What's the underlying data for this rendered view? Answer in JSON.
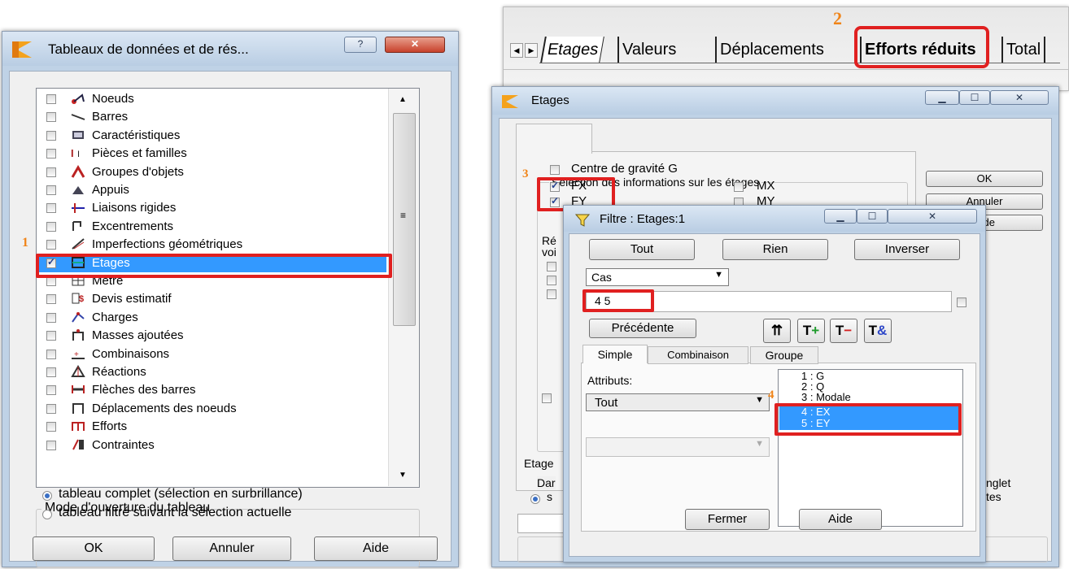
{
  "win1": {
    "title": "Tableaux de données et de rés...",
    "help_btn": "?",
    "close_btn": "✕",
    "items": [
      {
        "label": "Noeuds",
        "checked": false
      },
      {
        "label": "Barres",
        "checked": false
      },
      {
        "label": "Caractéristiques",
        "checked": false
      },
      {
        "label": "Pièces et familles",
        "checked": false
      },
      {
        "label": "Groupes d'objets",
        "checked": false
      },
      {
        "label": "Appuis",
        "checked": false
      },
      {
        "label": "Liaisons rigides",
        "checked": false
      },
      {
        "label": "Excentrements",
        "checked": false
      },
      {
        "label": "Imperfections géométriques",
        "checked": false
      },
      {
        "label": "Etages",
        "checked": true
      },
      {
        "label": "Métré",
        "checked": false
      },
      {
        "label": "Devis estimatif",
        "checked": false
      },
      {
        "label": "Charges",
        "checked": false
      },
      {
        "label": "Masses ajoutées",
        "checked": false
      },
      {
        "label": "Combinaisons",
        "checked": false
      },
      {
        "label": "Réactions",
        "checked": false
      },
      {
        "label": "Flèches des barres",
        "checked": false
      },
      {
        "label": "Déplacements des noeuds",
        "checked": false
      },
      {
        "label": "Efforts",
        "checked": false
      },
      {
        "label": "Contraintes",
        "checked": false
      }
    ],
    "mode_group_title": "Mode d'ouverture du tableau",
    "radio1": "tableau complet (sélection en surbrillance)",
    "radio2": "tableau filtré suivant la sélection actuelle",
    "ok": "OK",
    "cancel": "Annuler",
    "help": "Aide",
    "marker": "1"
  },
  "tabs": {
    "marker": "2",
    "items": [
      "Etages",
      "Valeurs",
      "Déplacements",
      "Efforts réduits",
      "Total"
    ]
  },
  "etages": {
    "title": "Etages",
    "group_title": "Sélection des informations sur les étages",
    "centre": "Centre de gravité G",
    "fx": "FX",
    "fy": "FY",
    "mx": "MX",
    "my": "MY",
    "marker": "3",
    "ok": "OK",
    "cancel": "Annuler",
    "help": "Aide",
    "partial1": "Ré",
    "partial2": "voi",
    "partial3": "Etage",
    "partial4": "Dar",
    "partial5": "s",
    "partial6": "nglet",
    "partial7": "tes"
  },
  "filtre": {
    "title": "Filtre : Etages:1",
    "tout": "Tout",
    "rien": "Rien",
    "inverser": "Inverser",
    "combo": "Cas",
    "input_value": "4 5",
    "precedente": "Précédente",
    "tab_simple": "Simple",
    "tab_comb": "Combinaison",
    "tab_groupe": "Groupe",
    "attributs": "Attributs:",
    "attr_combo": "Tout",
    "list": [
      "1 : G",
      "2 : Q",
      "3 : Modale",
      "4 : EX",
      "5 : EY"
    ],
    "marker": "4",
    "fermer": "Fermer",
    "aide": "Aide"
  }
}
